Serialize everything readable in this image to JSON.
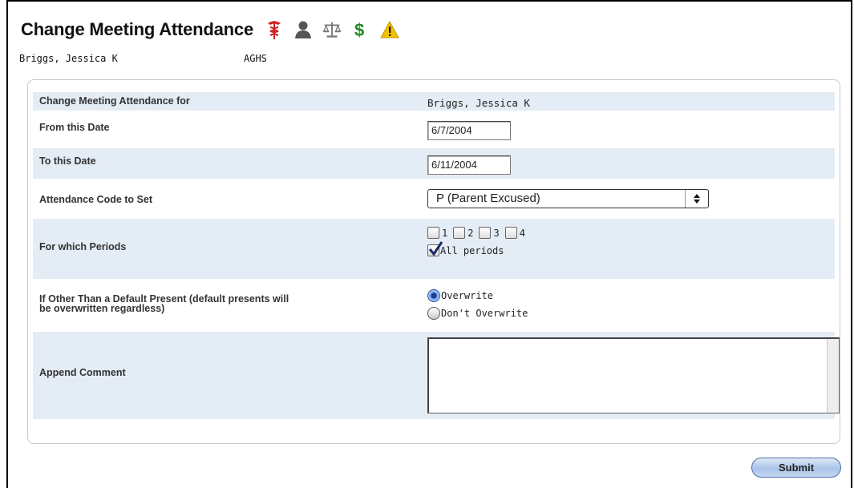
{
  "header": {
    "title": "Change Meeting Attendance",
    "student_name": "Briggs, Jessica K",
    "school": "AGHS",
    "alert_icons": [
      "medical-icon",
      "guardian-icon",
      "legal-icon",
      "fees-icon",
      "warning-icon"
    ]
  },
  "form": {
    "for_label": "Change Meeting Attendance for",
    "for_value": "Briggs, Jessica K",
    "from_label": "From this Date",
    "from_value": "6/7/2004",
    "to_label": "To this Date",
    "to_value": "6/11/2004",
    "code_label": "Attendance Code to Set",
    "code_value": "P (Parent Excused)",
    "periods_label": "For which Periods",
    "periods": [
      "1",
      "2",
      "3",
      "4"
    ],
    "all_periods_label": "All periods",
    "all_periods_checked": true,
    "overwrite_label_line1": "If Other Than a Default Present (default presents will",
    "overwrite_label_line2": "be overwritten regardless)",
    "overwrite_option": "Overwrite",
    "dont_overwrite_option": "Don't Overwrite",
    "overwrite_selected": "Overwrite",
    "comment_label": "Append Comment",
    "comment_value": ""
  },
  "actions": {
    "submit_label": "Submit"
  },
  "colors": {
    "row_alt": "#e4ecf5",
    "medical": "#cc2222",
    "fees": "#1e8a1e",
    "warning": "#f2c200"
  }
}
